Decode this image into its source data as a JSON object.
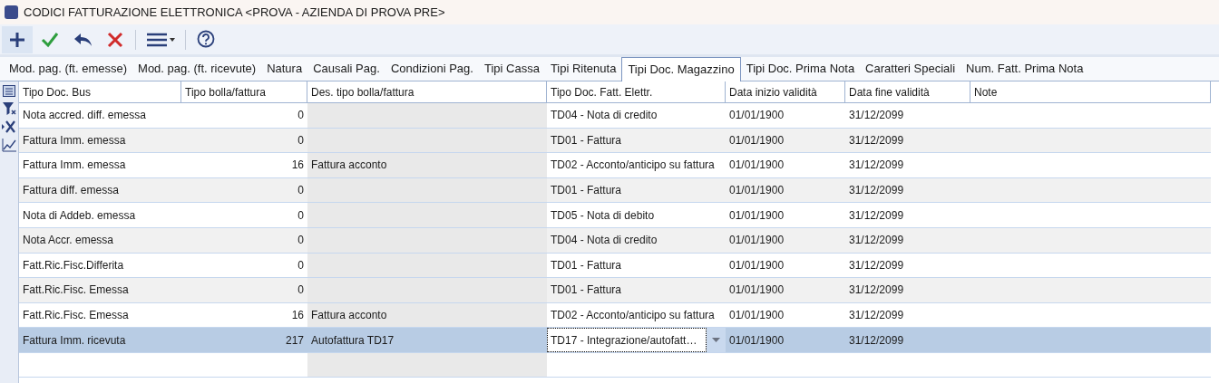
{
  "window": {
    "title": "CODICI FATTURAZIONE ELETTRONICA <PROVA - AZIENDA DI PROVA PRE>"
  },
  "tabs": [
    {
      "label": "Mod. pag. (ft. emesse)",
      "selected": false
    },
    {
      "label": "Mod. pag. (ft. ricevute)",
      "selected": false
    },
    {
      "label": "Natura",
      "selected": false
    },
    {
      "label": "Causali Pag.",
      "selected": false
    },
    {
      "label": "Condizioni Pag.",
      "selected": false
    },
    {
      "label": "Tipi Cassa",
      "selected": false
    },
    {
      "label": "Tipi Ritenuta",
      "selected": false
    },
    {
      "label": "Tipi Doc. Magazzino",
      "selected": true
    },
    {
      "label": "Tipi Doc. Prima Nota",
      "selected": false
    },
    {
      "label": "Caratteri Speciali",
      "selected": false
    },
    {
      "label": "Num. Fatt. Prima Nota",
      "selected": false
    }
  ],
  "table": {
    "columns": [
      "Tipo Doc. Bus",
      "Tipo bolla/fattura",
      "Des. tipo bolla/fattura",
      "Tipo Doc. Fatt. Elettr.",
      "Data inizio validità",
      "Data fine validità",
      "Note"
    ],
    "rows": [
      {
        "cells": [
          "Nota accred. diff. emessa",
          "0",
          "",
          "TD04 - Nota di credito",
          "01/01/1900",
          "31/12/2099",
          ""
        ],
        "selected": false,
        "editing": false
      },
      {
        "cells": [
          "Fattura Imm. emessa",
          "0",
          "",
          "TD01 - Fattura",
          "01/01/1900",
          "31/12/2099",
          ""
        ],
        "selected": false,
        "editing": false
      },
      {
        "cells": [
          "Fattura Imm. emessa",
          "16",
          "Fattura acconto",
          "TD02 - Acconto/anticipo su fattura",
          "01/01/1900",
          "31/12/2099",
          ""
        ],
        "selected": false,
        "editing": false
      },
      {
        "cells": [
          "Fattura diff. emessa",
          "0",
          "",
          "TD01 - Fattura",
          "01/01/1900",
          "31/12/2099",
          ""
        ],
        "selected": false,
        "editing": false
      },
      {
        "cells": [
          "Nota di Addeb. emessa",
          "0",
          "",
          "TD05 - Nota di debito",
          "01/01/1900",
          "31/12/2099",
          ""
        ],
        "selected": false,
        "editing": false
      },
      {
        "cells": [
          "Nota Accr. emessa",
          "0",
          "",
          "TD04 - Nota di credito",
          "01/01/1900",
          "31/12/2099",
          ""
        ],
        "selected": false,
        "editing": false
      },
      {
        "cells": [
          "Fatt.Ric.Fisc.Differita",
          "0",
          "",
          "TD01 - Fattura",
          "01/01/1900",
          "31/12/2099",
          ""
        ],
        "selected": false,
        "editing": false
      },
      {
        "cells": [
          "Fatt.Ric.Fisc. Emessa",
          "0",
          "",
          "TD01 - Fattura",
          "01/01/1900",
          "31/12/2099",
          ""
        ],
        "selected": false,
        "editing": false
      },
      {
        "cells": [
          "Fatt.Ric.Fisc. Emessa",
          "16",
          "Fattura acconto",
          "TD02 - Acconto/anticipo su fattura",
          "01/01/1900",
          "31/12/2099",
          ""
        ],
        "selected": false,
        "editing": false
      },
      {
        "cells": [
          "Fattura Imm. ricevuta",
          "217",
          "Autofattura TD17",
          "TD17 - Integrazione/autofatt…",
          "01/01/1900",
          "31/12/2099",
          ""
        ],
        "selected": true,
        "editing": true
      }
    ]
  }
}
